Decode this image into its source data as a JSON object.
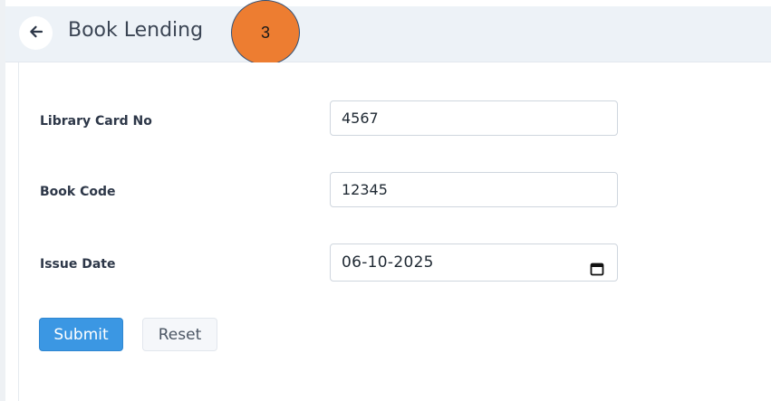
{
  "header": {
    "title": "Book Lending",
    "back_icon": "arrow-left-icon"
  },
  "annotation": {
    "step_number": "3",
    "color": "#ed7d31"
  },
  "form": {
    "fields": [
      {
        "label": "Library Card No",
        "value": "4567"
      },
      {
        "label": "Book Code",
        "value": "12345"
      },
      {
        "label": "Issue Date",
        "value": "06-10-2025",
        "icon": "calendar-icon"
      }
    ],
    "submit_label": "Submit",
    "reset_label": "Reset"
  },
  "colors": {
    "primary_button": "#3b97e3",
    "header_background": "#edf2f7"
  }
}
